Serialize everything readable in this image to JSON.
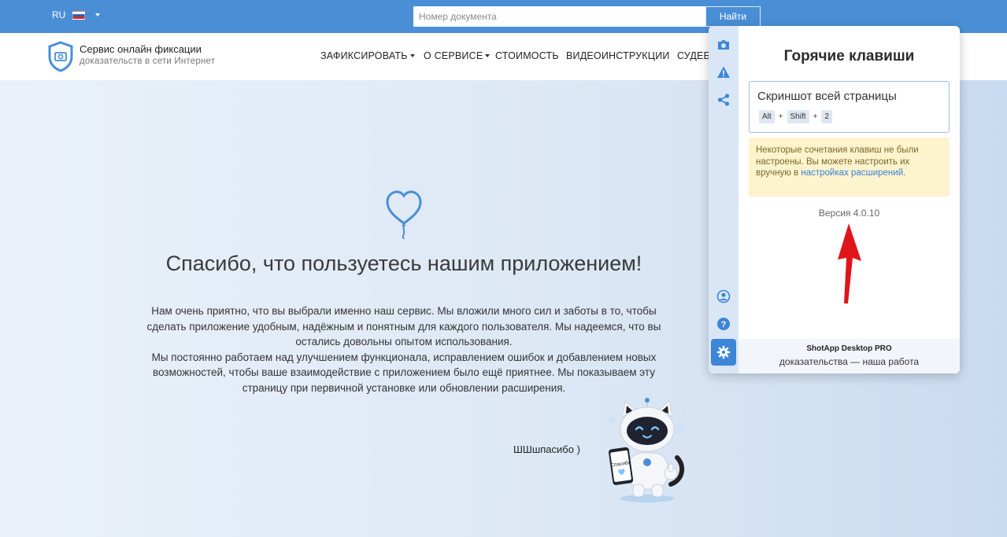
{
  "topbar": {
    "lang": "RU",
    "search_placeholder": "Номер документа",
    "search_value": "",
    "search_button": "Найти"
  },
  "brand": {
    "title": "Сервис онлайн фиксации",
    "subtitle": "доказательств в сети Интернет"
  },
  "nav": {
    "items": [
      {
        "label": "ЗАФИКСИРОВАТЬ",
        "has_caret": true
      },
      {
        "label": "О СЕРВИСЕ",
        "has_caret": true
      },
      {
        "label": "СТОИМОСТЬ",
        "has_caret": false
      },
      {
        "label": "ВИДЕОИНСТРУКЦИИ",
        "has_caret": false
      },
      {
        "label": "СУДЕБ",
        "has_caret": false
      }
    ]
  },
  "main": {
    "headline": "Спасибо, что пользуетесь нашим приложением!",
    "body_lines": [
      "Нам очень приятно, что вы выбрали именно наш сервис. Мы вложили много сил и заботы в то, чтобы",
      "сделать приложение удобным, надёжным и понятным для каждого пользователя. Мы надеемся, что вы",
      "остались довольны опытом использования.",
      "Мы постоянно работаем над улучшением функционала, исправлением ошибок и добавлением новых",
      "возможностей, чтобы ваше взаимодействие с приложением было ещё приятнее. Мы показываем эту",
      "страницу при первичной установке или обновлении расширения."
    ],
    "thanks_text": "ШШшпасибо )",
    "mascot_sign": "Спасибо"
  },
  "popup": {
    "title": "Горячие клавиши",
    "card_title": "Скриншот всей страницы",
    "keys": [
      "Alt",
      "Shift",
      "2"
    ],
    "key_separator": "+",
    "warning_text": "Некоторые сочетания клавиш не были настроены. Вы можете настроить их вручную в ",
    "warning_link": "настройках расширений",
    "warning_end": ".",
    "version": "Версия 4.0.10",
    "footer_brand": "ShotApp Desktop PRO",
    "footer_tagline": "доказательства — наша работа",
    "rail_icons": [
      "camera-icon",
      "warning-icon",
      "share-icon",
      "user-icon",
      "help-icon",
      "settings-icon"
    ]
  },
  "colors": {
    "topbar": "#4a8fd6",
    "accent": "#3d86d6",
    "warning_bg": "#fdf3cd",
    "arrow": "#e0151c"
  }
}
